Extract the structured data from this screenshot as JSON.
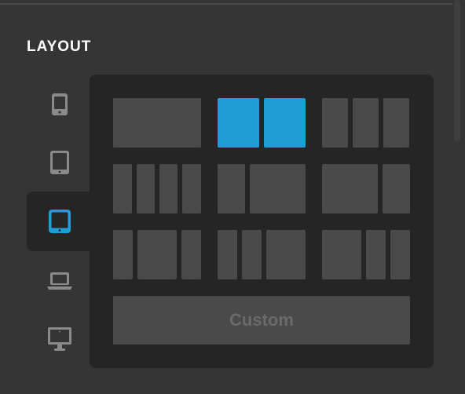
{
  "section": {
    "title": "LAYOUT"
  },
  "devices": [
    {
      "name": "phone",
      "icon": "phone-icon",
      "active": false
    },
    {
      "name": "tablet-portrait",
      "icon": "tablet-portrait-icon",
      "active": false
    },
    {
      "name": "tablet-landscape",
      "icon": "tablet-landscape-icon",
      "active": true
    },
    {
      "name": "laptop",
      "icon": "laptop-icon",
      "active": false
    },
    {
      "name": "desktop",
      "icon": "desktop-icon",
      "active": false
    }
  ],
  "layouts": [
    {
      "id": "1-col",
      "selected": false
    },
    {
      "id": "2-col-equal",
      "selected": true
    },
    {
      "id": "3-col-equal",
      "selected": false
    },
    {
      "id": "4-col-equal",
      "selected": false
    },
    {
      "id": "1-2",
      "selected": false
    },
    {
      "id": "2-1",
      "selected": false
    },
    {
      "id": "1-2-1",
      "selected": false
    },
    {
      "id": "1-1-2",
      "selected": false
    },
    {
      "id": "2-1-1",
      "selected": false
    }
  ],
  "custom": {
    "label": "Custom"
  },
  "colors": {
    "accent": "#1f9ed6",
    "background": "#353535",
    "panel": "#252525",
    "tile": "#4a4a4a",
    "icon": "#8a8a8a"
  }
}
